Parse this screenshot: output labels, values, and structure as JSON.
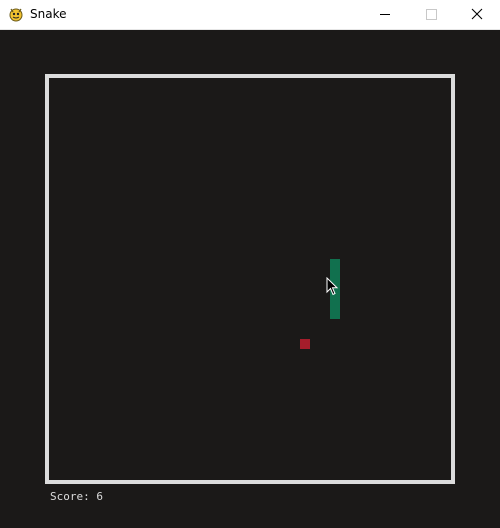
{
  "window": {
    "title": "Snake",
    "icon": "pygame-snake-icon",
    "controls": [
      "minimize-icon",
      "maximize-icon",
      "close-icon"
    ]
  },
  "game": {
    "score_label": "Score: 6",
    "score": 6,
    "colors": {
      "background": "#1b1918",
      "border": "#dcdcdc",
      "snake": "#11704e",
      "food": "#a51d2b",
      "text": "#dcdcdc"
    }
  }
}
